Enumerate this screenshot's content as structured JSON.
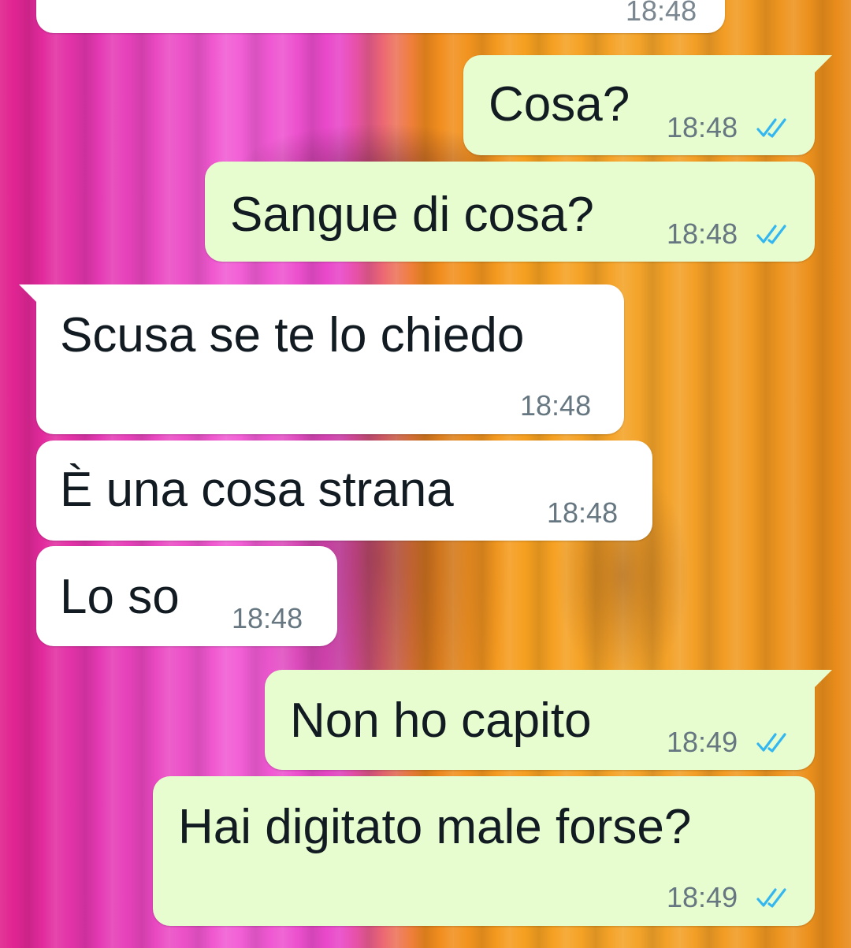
{
  "chat": {
    "wallpaper": {
      "colors": [
        "#e0208c",
        "#f25fd6",
        "#f08a1e",
        "#f6a020"
      ]
    },
    "colors": {
      "outgoing_bubble": "#e7fccf",
      "incoming_bubble": "#ffffff",
      "read_check": "#34b7f1",
      "time_text": "#667781",
      "message_text": "#111b21"
    },
    "messages": [
      {
        "direction": "in",
        "text": "",
        "time": "18:48"
      },
      {
        "direction": "out",
        "text": "Cosa?",
        "time": "18:48",
        "status": "read",
        "status_icon": "double-check-icon"
      },
      {
        "direction": "out",
        "text": "Sangue di cosa?",
        "time": "18:48",
        "status": "read",
        "status_icon": "double-check-icon"
      },
      {
        "direction": "in",
        "text": "Scusa se te lo chiedo",
        "time": "18:48"
      },
      {
        "direction": "in",
        "text": "È una cosa strana",
        "time": "18:48"
      },
      {
        "direction": "in",
        "text": "Lo so",
        "time": "18:48"
      },
      {
        "direction": "out",
        "text": "Non ho capito",
        "time": "18:49",
        "status": "read",
        "status_icon": "double-check-icon"
      },
      {
        "direction": "out",
        "text": "Hai digitato male forse?",
        "time": "18:49",
        "status": "read",
        "status_icon": "double-check-icon"
      }
    ]
  }
}
